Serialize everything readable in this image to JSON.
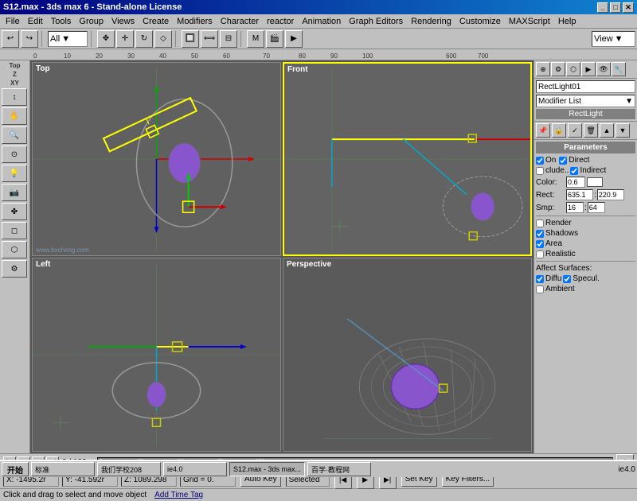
{
  "titleBar": {
    "title": "S12.max - 3ds max 6 - Stand-alone License",
    "minBtn": "_",
    "maxBtn": "□",
    "closeBtn": "✕"
  },
  "menuBar": {
    "items": [
      "File",
      "Edit",
      "Tools",
      "Group",
      "Views",
      "Create",
      "Modifiers",
      "Character",
      "reactor",
      "Animation",
      "Graph Editors",
      "Rendering",
      "Customize",
      "MAXScript",
      "Help"
    ]
  },
  "toolbar": {
    "undoBtn": "↩",
    "redoBtn": "↪",
    "selectAll": "All",
    "viewDropdown": "View"
  },
  "leftPanel": {
    "labels": [
      "Top",
      "Z",
      "XY"
    ],
    "tools": [
      "↕",
      "⬡",
      "⬡",
      "⬡",
      "⬡",
      "⬡",
      "⬡",
      "⬡",
      "⬡",
      "⬡",
      "⬡",
      "⬡",
      "⬡"
    ]
  },
  "viewports": [
    {
      "id": "top",
      "label": "Top",
      "active": false
    },
    {
      "id": "front",
      "label": "Front",
      "active": true
    },
    {
      "id": "left",
      "label": "Left",
      "active": false
    },
    {
      "id": "perspective",
      "label": "Perspective",
      "active": false
    }
  ],
  "rightPanel": {
    "objectName": "RectLight01",
    "modifierDropdown": "Modifier List",
    "modifierLabel": "RectLight",
    "iconRow": [
      "📌",
      "⚙",
      "🗑",
      "↑",
      "↓",
      "📋",
      "📌"
    ]
  },
  "parameters": {
    "header": "Parameters",
    "onCheck": true,
    "onLabel": "On",
    "directCheck": true,
    "directLabel": "Direct",
    "excludeCheck": false,
    "excludeLabel": "clude..",
    "indirectCheck": true,
    "indirectLabel": "Indirect",
    "colorLabel": "Color:",
    "colorValue": "0.6",
    "rectLabel": "Rect:",
    "rectW": "635.1",
    "rectH": "220.9",
    "smpLabel": "Smp:",
    "smpV": "16",
    "smpV2": "64",
    "renderCheck": false,
    "renderLabel": "Render",
    "shadowsCheck": true,
    "shadowsLabel": "Shadows",
    "areaCheck": true,
    "areaLabel": "Area",
    "realisticCheck": false,
    "realisticLabel": "Realistic",
    "affectSurfaces": "Affect Surfaces:",
    "diffuLabel": "Diffu",
    "specuCheck": true,
    "specuLabel": "Specul.",
    "ambientLabel": "Ambient"
  },
  "timeline": {
    "current": "0",
    "total": "100",
    "marks": [
      "0",
      "10",
      "20",
      "30",
      "40",
      "50",
      "60",
      "70",
      "80",
      "90",
      "100"
    ]
  },
  "statusBar": {
    "xCoord": "X: -1495.2r",
    "yCoord": "Y: -41.592r",
    "zCoord": "Z: 1089.298",
    "gridLabel": "Grid = 0.",
    "autoKeyBtn": "Auto Key",
    "selectedLabel": "Selected",
    "setKeyBtn": "Set Key",
    "keyFiltersBtn": "Key Filters...",
    "statusMsg": "Click and drag to select and move object",
    "addTimeTag": "Add Time Tag"
  },
  "taskbar": {
    "startLabel": "开始",
    "tasks": [
      {
        "label": "标准",
        "active": false
      },
      {
        "label": "我们学校208",
        "active": false
      },
      {
        "label": "ie4.0",
        "active": false
      },
      {
        "label": "S12.max - 3ds max...",
        "active": true
      },
      {
        "label": "百学·教程网",
        "active": false
      }
    ],
    "time": "ie4.0"
  },
  "watermark": "百学·教程网 www.bxcheng.com"
}
